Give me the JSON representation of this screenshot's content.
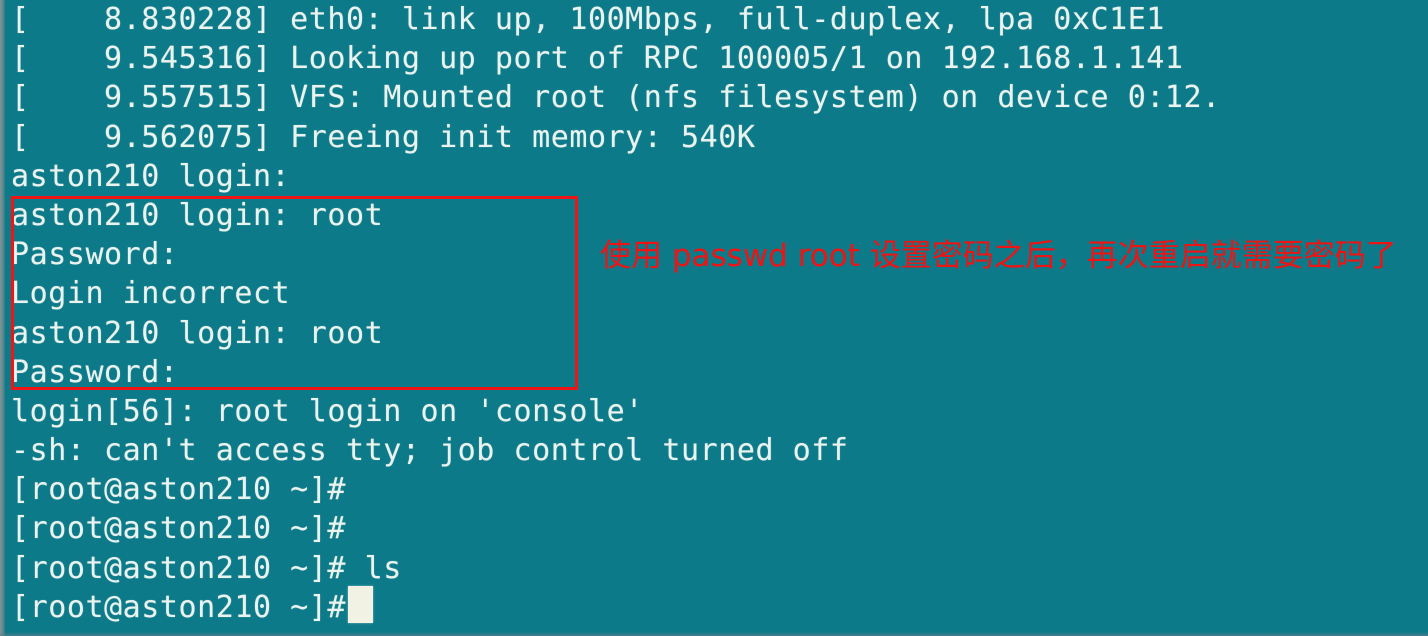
{
  "terminal": {
    "background_color": "#0d7a8a",
    "text_color": "#e9f3ef",
    "annotation_color": "#ef1414",
    "hostname": "aston210",
    "lines": [
      "[    8.830228] eth0: link up, 100Mbps, full-duplex, lpa 0xC1E1",
      "[    9.545316] Looking up port of RPC 100005/1 on 192.168.1.141",
      "[    9.557515] VFS: Mounted root (nfs filesystem) on device 0:12.",
      "[    9.562075] Freeing init memory: 540K",
      "aston210 login:",
      "aston210 login: root",
      "Password:",
      "Login incorrect",
      "aston210 login: root",
      "Password:",
      "login[56]: root login on 'console'",
      "-sh: can't access tty; job control turned off",
      "[root@aston210 ~]#",
      "[root@aston210 ~]#",
      "[root@aston210 ~]# ls",
      "[root@aston210 ~]# "
    ],
    "boot_messages": [
      {
        "timestamp": "8.830228",
        "message": "eth0: link up, 100Mbps, full-duplex, lpa 0xC1E1"
      },
      {
        "timestamp": "9.545316",
        "message": "Looking up port of RPC 100005/1 on 192.168.1.141"
      },
      {
        "timestamp": "9.557515",
        "message": "VFS: Mounted root (nfs filesystem) on device 0:12."
      },
      {
        "timestamp": "9.562075",
        "message": "Freeing init memory: 540K"
      }
    ],
    "login_prompt": "aston210 login:",
    "username_entered": "root",
    "password_prompt": "Password:",
    "error_message": "Login incorrect",
    "login_session_message": "login[56]: root login on 'console'",
    "shell_warning": "-sh: can't access tty; job control turned off",
    "shell_prompt": "[root@aston210 ~]#",
    "last_command": "ls"
  },
  "annotation": {
    "text": "使用 passwd root 设置密码之后，再次重启就需要密码了",
    "color": "#ef1414"
  },
  "highlight_box": {
    "color": "#f01414",
    "covers": "login attempts block"
  },
  "cursor": {
    "shape": "block",
    "color": "#f2f2e4"
  }
}
